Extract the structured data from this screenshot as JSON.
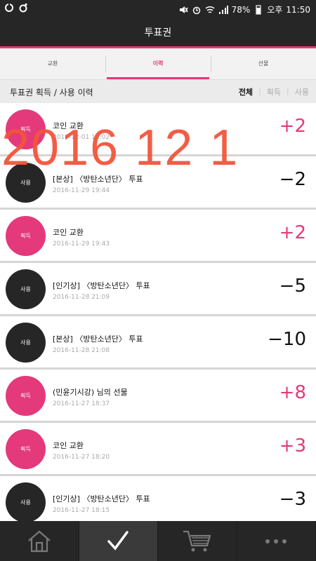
{
  "status_bar": {
    "battery": "78%",
    "ampm": "오후",
    "time": "11:50"
  },
  "header": {
    "title": "투표권"
  },
  "tabs": [
    {
      "label": "교환",
      "active": false
    },
    {
      "label": "이력",
      "active": true
    },
    {
      "label": "선물",
      "active": false
    }
  ],
  "filter": {
    "title": "투표권 획득 / 사용 이력",
    "options": [
      {
        "label": "전체",
        "selected": true
      },
      {
        "label": "획득",
        "selected": false
      },
      {
        "label": "사용",
        "selected": false
      }
    ]
  },
  "history": [
    {
      "badge": "획득",
      "kind": "gain",
      "title": "코인 교환",
      "date": "2016-12-01 18:02",
      "amount": "+2"
    },
    {
      "badge": "사용",
      "kind": "use",
      "title": "[본상] 〈방탄소년단〉 투표",
      "date": "2016-11-29 19:44",
      "amount": "−2"
    },
    {
      "badge": "획득",
      "kind": "gain",
      "title": "코인 교환",
      "date": "2016-11-29 19:43",
      "amount": "+2"
    },
    {
      "badge": "사용",
      "kind": "use",
      "title": "[인기상] 〈방탄소년단〉 투표",
      "date": "2016-11-28 21:09",
      "amount": "−5"
    },
    {
      "badge": "사용",
      "kind": "use",
      "title": "[본상] 〈방탄소년단〉 투표",
      "date": "2016-11-28 21:08",
      "amount": "−10"
    },
    {
      "badge": "획득",
      "kind": "gain",
      "title": "(민윤기시강) 님의 선물",
      "date": "2016-11-27 18:37",
      "amount": "+8"
    },
    {
      "badge": "획득",
      "kind": "gain",
      "title": "코인 교환",
      "date": "2016-11-27 18:20",
      "amount": "+3"
    },
    {
      "badge": "사용",
      "kind": "use",
      "title": "[인기상] 〈방탄소년단〉 투표",
      "date": "2016-11-27 18:15",
      "amount": "−3"
    }
  ],
  "overlay_text": "2016 12 1",
  "bottom_nav": [
    {
      "icon": "home-icon",
      "active": false
    },
    {
      "icon": "check-icon",
      "active": true
    },
    {
      "icon": "cart-icon",
      "active": false
    },
    {
      "icon": "more-icon",
      "active": false
    }
  ],
  "colors": {
    "accent": "#e4397a",
    "dark": "#262626",
    "overlay": "#f2553a"
  }
}
